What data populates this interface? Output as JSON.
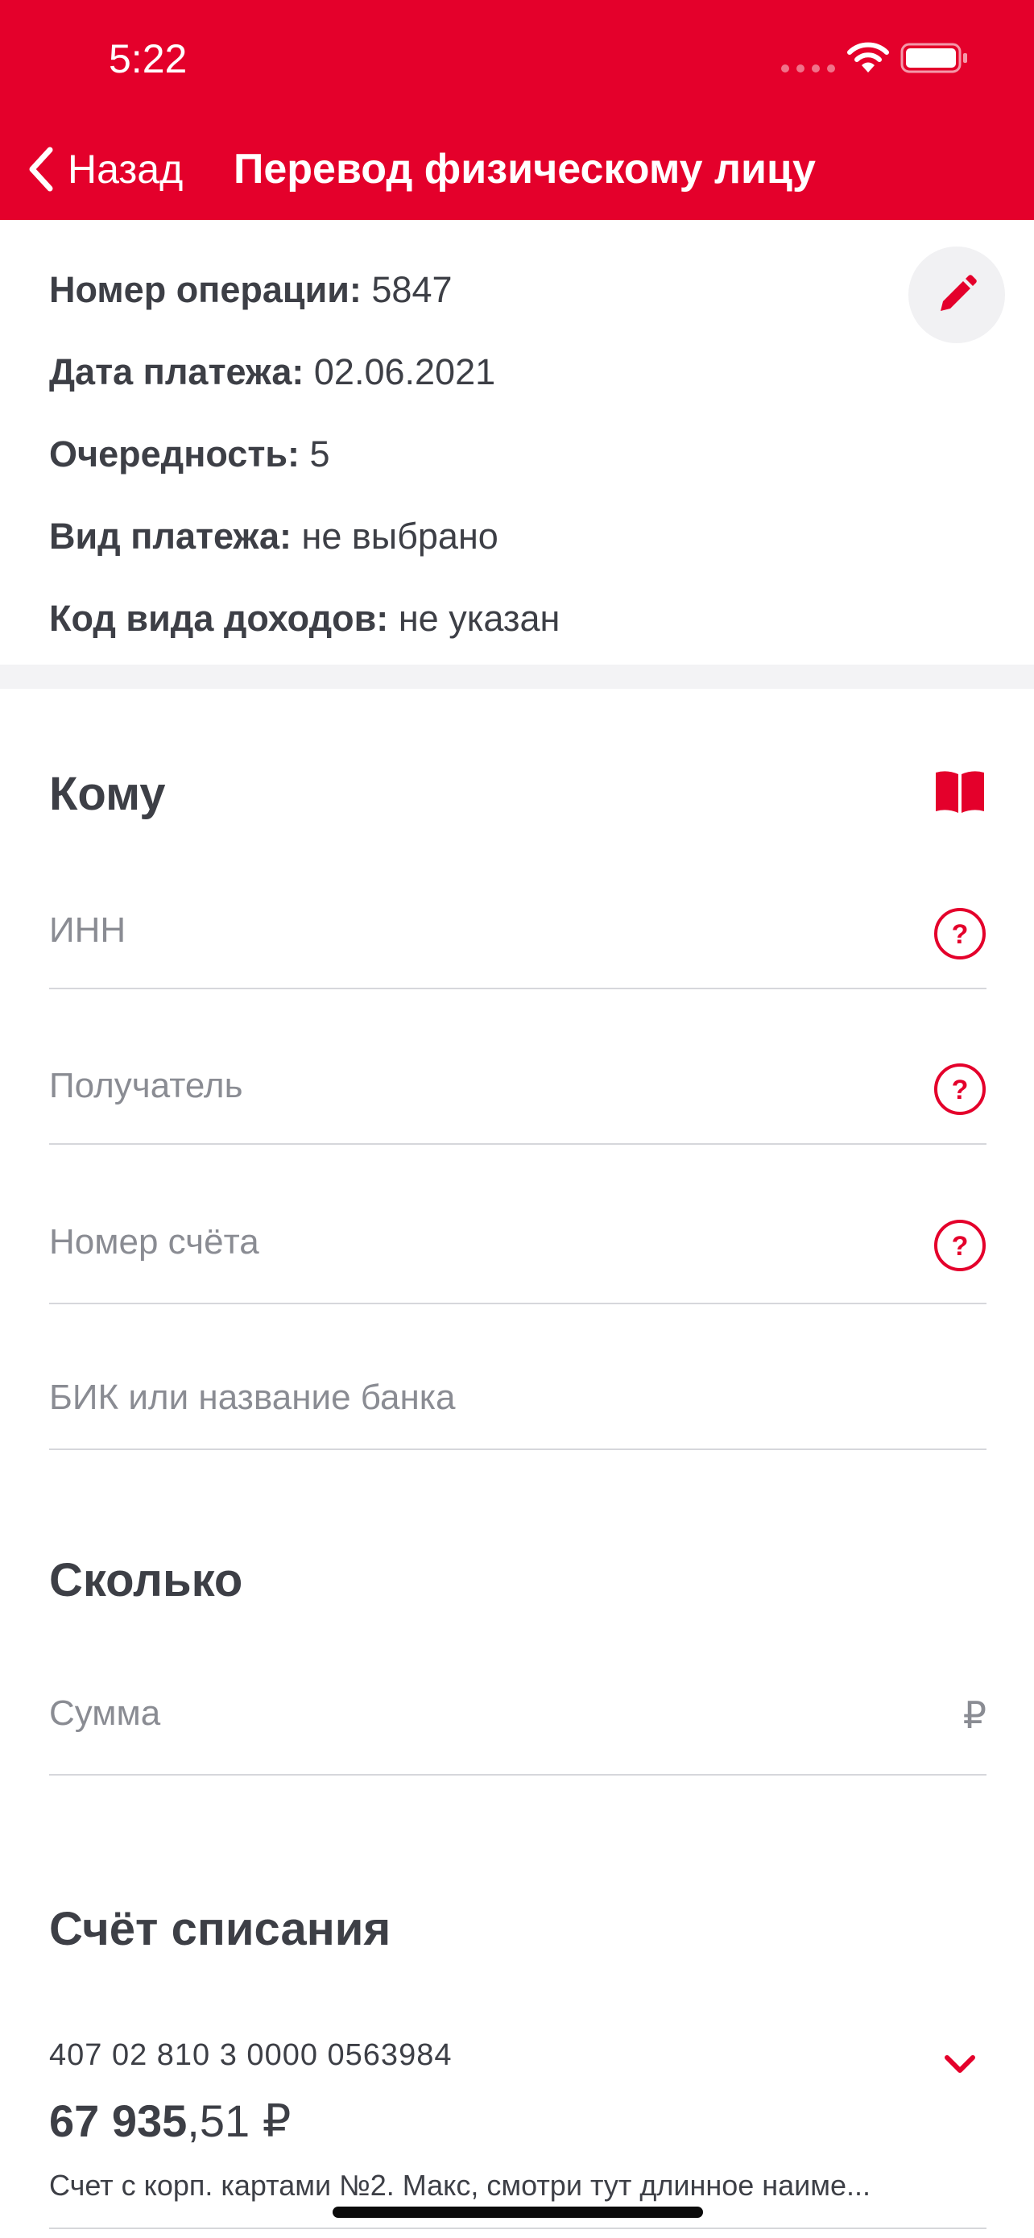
{
  "status": {
    "time": "5:22"
  },
  "nav": {
    "back_label": "Назад",
    "title": "Перевод физическому лицу"
  },
  "info": {
    "operation_label": "Номер операции:",
    "operation_value": "5847",
    "date_label": "Дата платежа:",
    "date_value": "02.06.2021",
    "priority_label": "Очередность:",
    "priority_value": "5",
    "type_label": "Вид платежа:",
    "type_value": "не выбрано",
    "income_label": "Код вида доходов:",
    "income_value": "не указан"
  },
  "to_section": {
    "title": "Кому",
    "inn_placeholder": "ИНН",
    "recipient_placeholder": "Получатель",
    "account_placeholder": "Номер счёта",
    "bank_placeholder": "БИК или название банка"
  },
  "amount_section": {
    "title": "Сколько",
    "amount_placeholder": "Сумма",
    "currency": "₽"
  },
  "debit_section": {
    "title": "Счёт списания",
    "account_number": "407 02 810 3 0000 0563984",
    "balance_int": "67 935",
    "balance_frac": ",51 ₽",
    "description": "Счет с корп. картами №2. Макс, смотри тут длинное наиме..."
  },
  "icons": {
    "back": "chevron-left-icon",
    "edit": "pencil-icon",
    "book": "book-icon",
    "help": "question-circle-icon",
    "expand": "chevron-down-icon"
  },
  "colors": {
    "brand": "#e4002b",
    "text": "#3d3f46",
    "placeholder": "#8a8c93"
  }
}
